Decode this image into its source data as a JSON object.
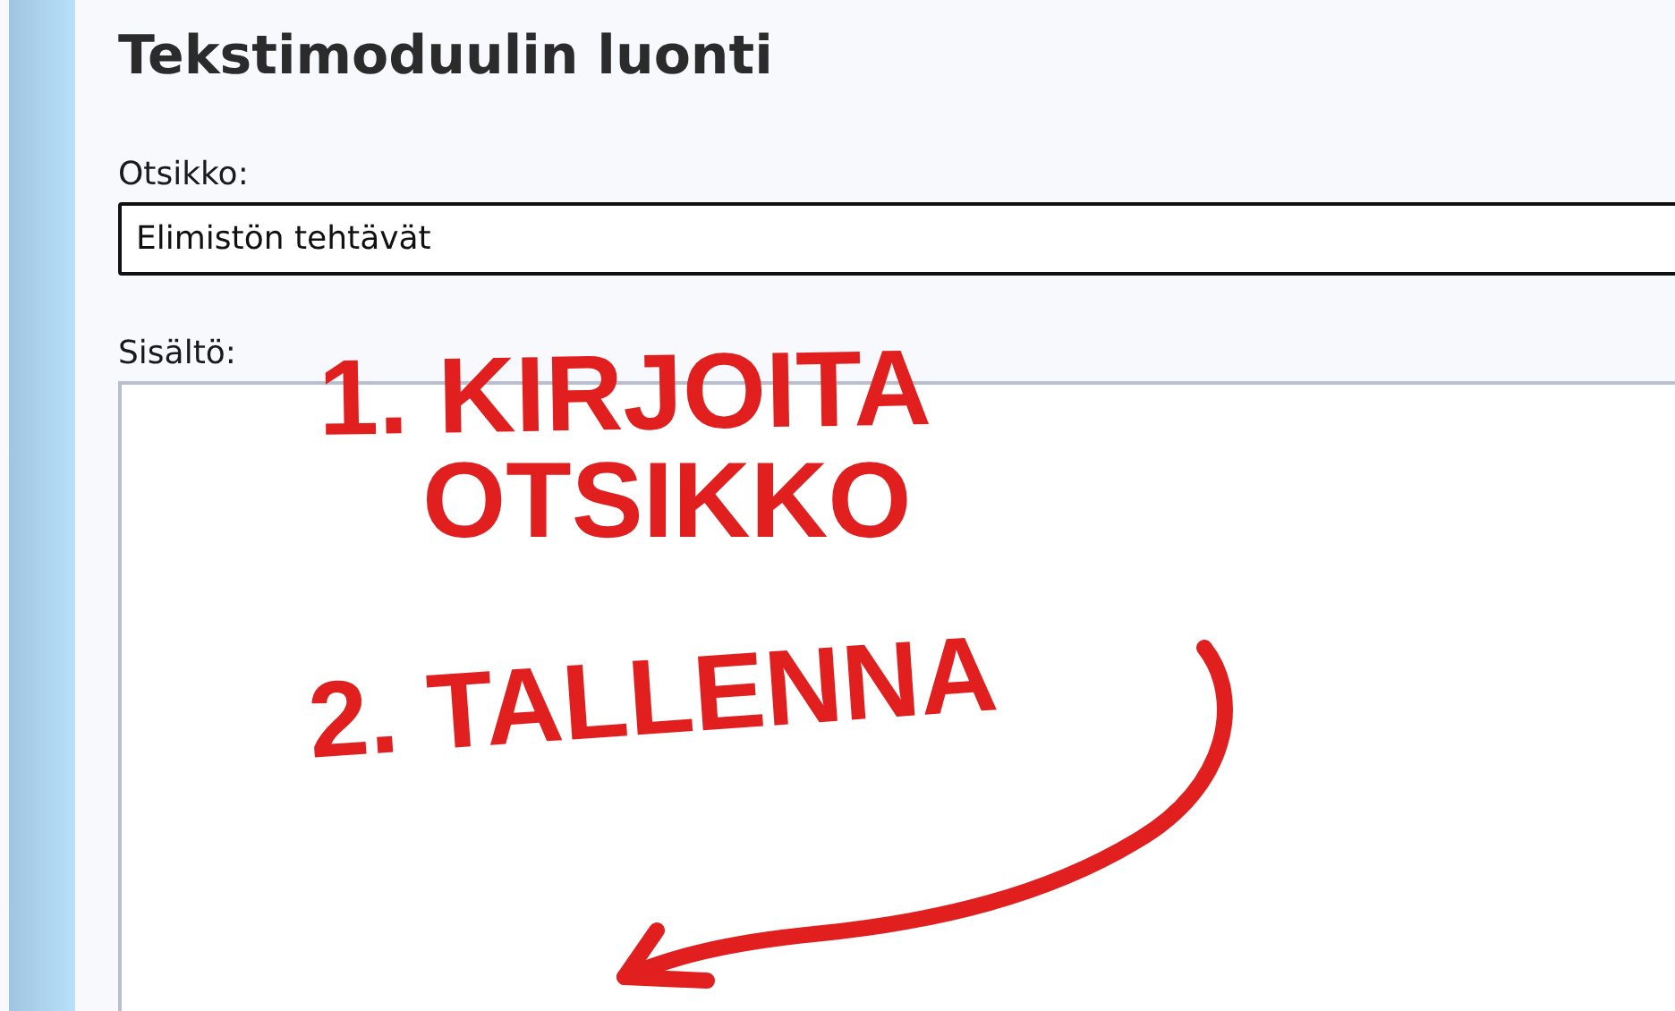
{
  "page": {
    "title": "Tekstimoduulin luonti"
  },
  "fields": [
    {
      "kind": "input",
      "label": "Otsikko:",
      "value": "Elimistön tehtävät"
    },
    {
      "kind": "textarea",
      "label": "Sisältö:"
    }
  ],
  "annotations": [
    {
      "kind": "text",
      "text": "1. KIRJOITA"
    },
    {
      "kind": "text",
      "text": "OTSIKKO"
    },
    {
      "kind": "text",
      "text": "2. TALLENNA"
    },
    {
      "kind": "arrow"
    }
  ]
}
